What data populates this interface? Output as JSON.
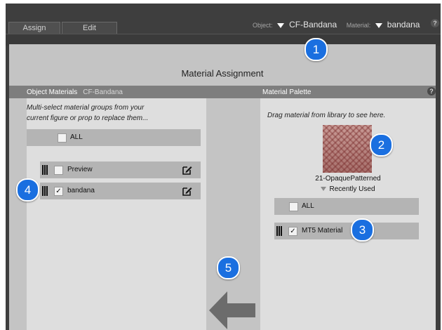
{
  "tabs": [
    {
      "label": "Assign"
    },
    {
      "label": "Edit"
    }
  ],
  "object_selector": {
    "label": "Object:",
    "value": "CF-Bandana"
  },
  "material_selector": {
    "label": "Material:",
    "value": "bandana"
  },
  "help_glyph": "?",
  "panel_title": "Material Assignment",
  "object_materials": {
    "header": "Object Materials",
    "figure": "CF-Bandana",
    "instructions_line1": "Multi-select material groups from your",
    "instructions_line2": "current figure or prop to replace them...",
    "all_label": "ALL",
    "items": [
      {
        "label": "Preview",
        "checked": false,
        "check": ""
      },
      {
        "label": "bandana",
        "checked": true,
        "check": "✓"
      }
    ]
  },
  "material_palette": {
    "header": "Material Palette",
    "instructions": "Drag material from library to see here.",
    "swatch_label": "21-OpaquePatterned",
    "recently_used": "Recently Used",
    "all_label": "ALL",
    "items": [
      {
        "label": "MT5 Material",
        "checked": true,
        "check": "✓"
      }
    ]
  },
  "callouts": [
    "1",
    "2",
    "3",
    "4",
    "5"
  ],
  "colors": {
    "callout": "#1a6fe0",
    "background": "#c4c4c4",
    "topbar": "#3e3e3e"
  }
}
